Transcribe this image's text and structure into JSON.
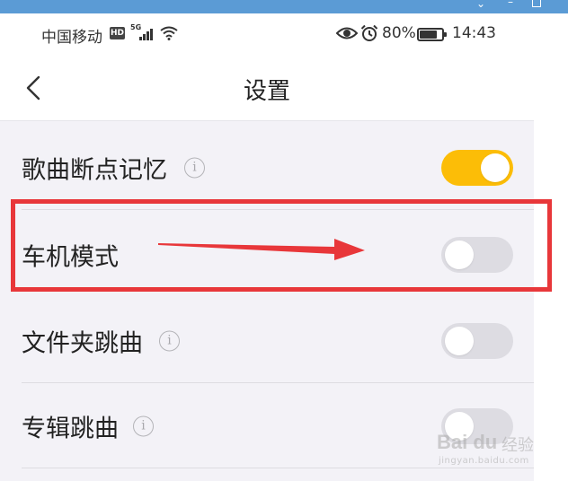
{
  "status_bar": {
    "carrier": "中国移动",
    "hd_badge": "HD",
    "network": "5G",
    "battery_percent": "80%",
    "battery_level": 0.8,
    "time": "14:43",
    "icons": [
      "hd-badge-icon",
      "signal-bars-icon",
      "wifi-icon",
      "eye-icon",
      "alarm-clock-icon",
      "battery-icon"
    ]
  },
  "header": {
    "title": "设置",
    "back_icon": "chevron-left-icon"
  },
  "settings": [
    {
      "label": "歌曲断点记忆",
      "info": "i",
      "enabled": true
    },
    {
      "label": "车机模式",
      "info": "",
      "enabled": false
    },
    {
      "label": "文件夹跳曲",
      "info": "i",
      "enabled": false
    },
    {
      "label": "专辑跳曲",
      "info": "i",
      "enabled": false
    }
  ],
  "annotation": {
    "highlight_color": "#e8373a",
    "target": "车机模式"
  },
  "watermark": {
    "logo": "Bai du",
    "sub": "经验",
    "url": "jingyan.baidu.com"
  },
  "colors": {
    "toggle_on": "#fcbd07",
    "toggle_off": "#dddce2",
    "page_background": "#f3f2f7",
    "window_accent": "#5b9bd5"
  }
}
